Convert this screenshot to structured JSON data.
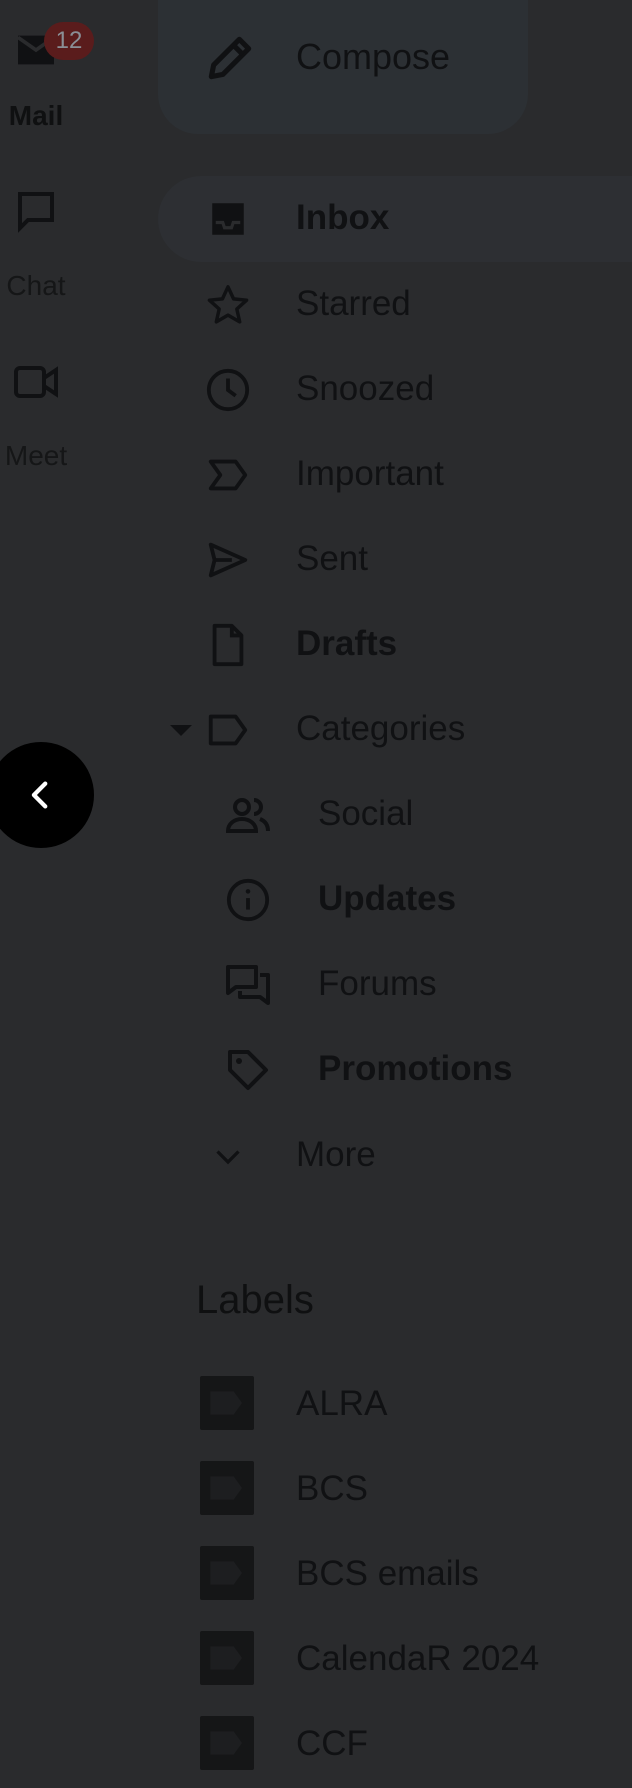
{
  "rail": {
    "items": [
      {
        "label": "Mail",
        "icon": "mail-icon",
        "badge": "12",
        "active": true
      },
      {
        "label": "Chat",
        "icon": "chat-icon"
      },
      {
        "label": "Meet",
        "icon": "video-icon"
      }
    ]
  },
  "compose": {
    "label": "Compose",
    "icon": "pencil-icon"
  },
  "nav": {
    "items": [
      {
        "label": "Inbox",
        "icon": "inbox-icon",
        "bold": true,
        "active": true
      },
      {
        "label": "Starred",
        "icon": "star-icon"
      },
      {
        "label": "Snoozed",
        "icon": "clock-icon"
      },
      {
        "label": "Important",
        "icon": "important-icon"
      },
      {
        "label": "Sent",
        "icon": "send-icon"
      },
      {
        "label": "Drafts",
        "icon": "draft-icon",
        "bold": true
      },
      {
        "label": "Categories",
        "icon": "label-outline-icon",
        "expanded": true
      }
    ],
    "categories": [
      {
        "label": "Social",
        "icon": "people-icon"
      },
      {
        "label": "Updates",
        "icon": "info-icon",
        "bold": true
      },
      {
        "label": "Forums",
        "icon": "forum-icon"
      },
      {
        "label": "Promotions",
        "icon": "tag-icon",
        "bold": true
      }
    ],
    "more": {
      "label": "More",
      "icon": "chevron-down-icon"
    }
  },
  "labels": {
    "heading": "Labels",
    "items": [
      {
        "label": "ALRA"
      },
      {
        "label": "BCS"
      },
      {
        "label": "BCS emails"
      },
      {
        "label": "CalendaR 2024"
      },
      {
        "label": "CCF"
      }
    ]
  },
  "fab": {
    "icon": "chevron-left-icon"
  },
  "colors": {
    "background": "#2a2b2d",
    "badge": "#5a1c1c",
    "text": "#101113",
    "active_bg": "#2d2f33"
  }
}
